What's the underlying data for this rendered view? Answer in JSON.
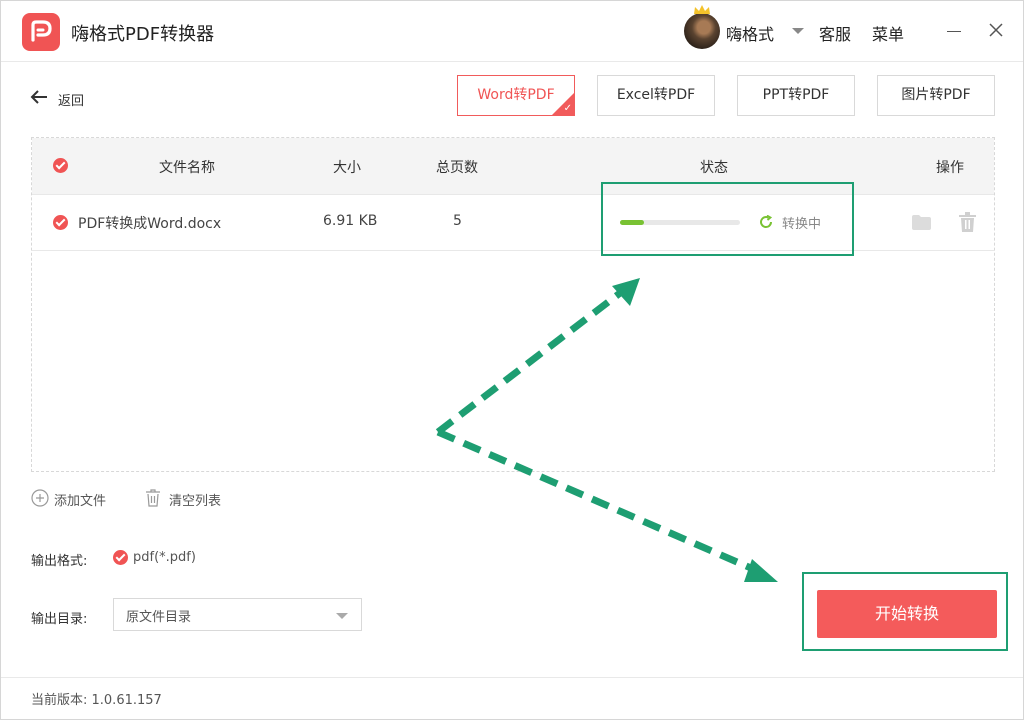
{
  "app": {
    "title": "嗨格式PDF转换器",
    "brand_color": "#f05454"
  },
  "header": {
    "username": "嗨格式",
    "service_label": "客服",
    "menu_label": "菜单",
    "icons": [
      "app-logo-icon",
      "crown-icon",
      "caret-down-icon",
      "minimize-icon",
      "close-icon"
    ]
  },
  "nav": {
    "back_label": "返回"
  },
  "tabs": [
    {
      "label": "Word转PDF",
      "active": true
    },
    {
      "label": "Excel转PDF",
      "active": false
    },
    {
      "label": "PPT转PDF",
      "active": false
    },
    {
      "label": "图片转PDF",
      "active": false
    }
  ],
  "table": {
    "headers": {
      "name": "文件名称",
      "size": "大小",
      "pages": "总页数",
      "status": "状态",
      "actions": "操作"
    },
    "rows": [
      {
        "name": "PDF转换成Word.docx",
        "size": "6.91 KB",
        "pages": "5",
        "status": "转换中",
        "progress": 0.2,
        "selected": true
      }
    ]
  },
  "actions": {
    "add_file": "添加文件",
    "clear_list": "清空列表"
  },
  "output": {
    "format_label": "输出格式:",
    "format_value": "pdf(*.pdf)",
    "dir_label": "输出目录:",
    "dir_value": "原文件目录"
  },
  "start_button": "开始转换",
  "footer": {
    "version": "当前版本: 1.0.61.157"
  },
  "annotation_color": "#1e9e72",
  "progress_color": "#79c233"
}
